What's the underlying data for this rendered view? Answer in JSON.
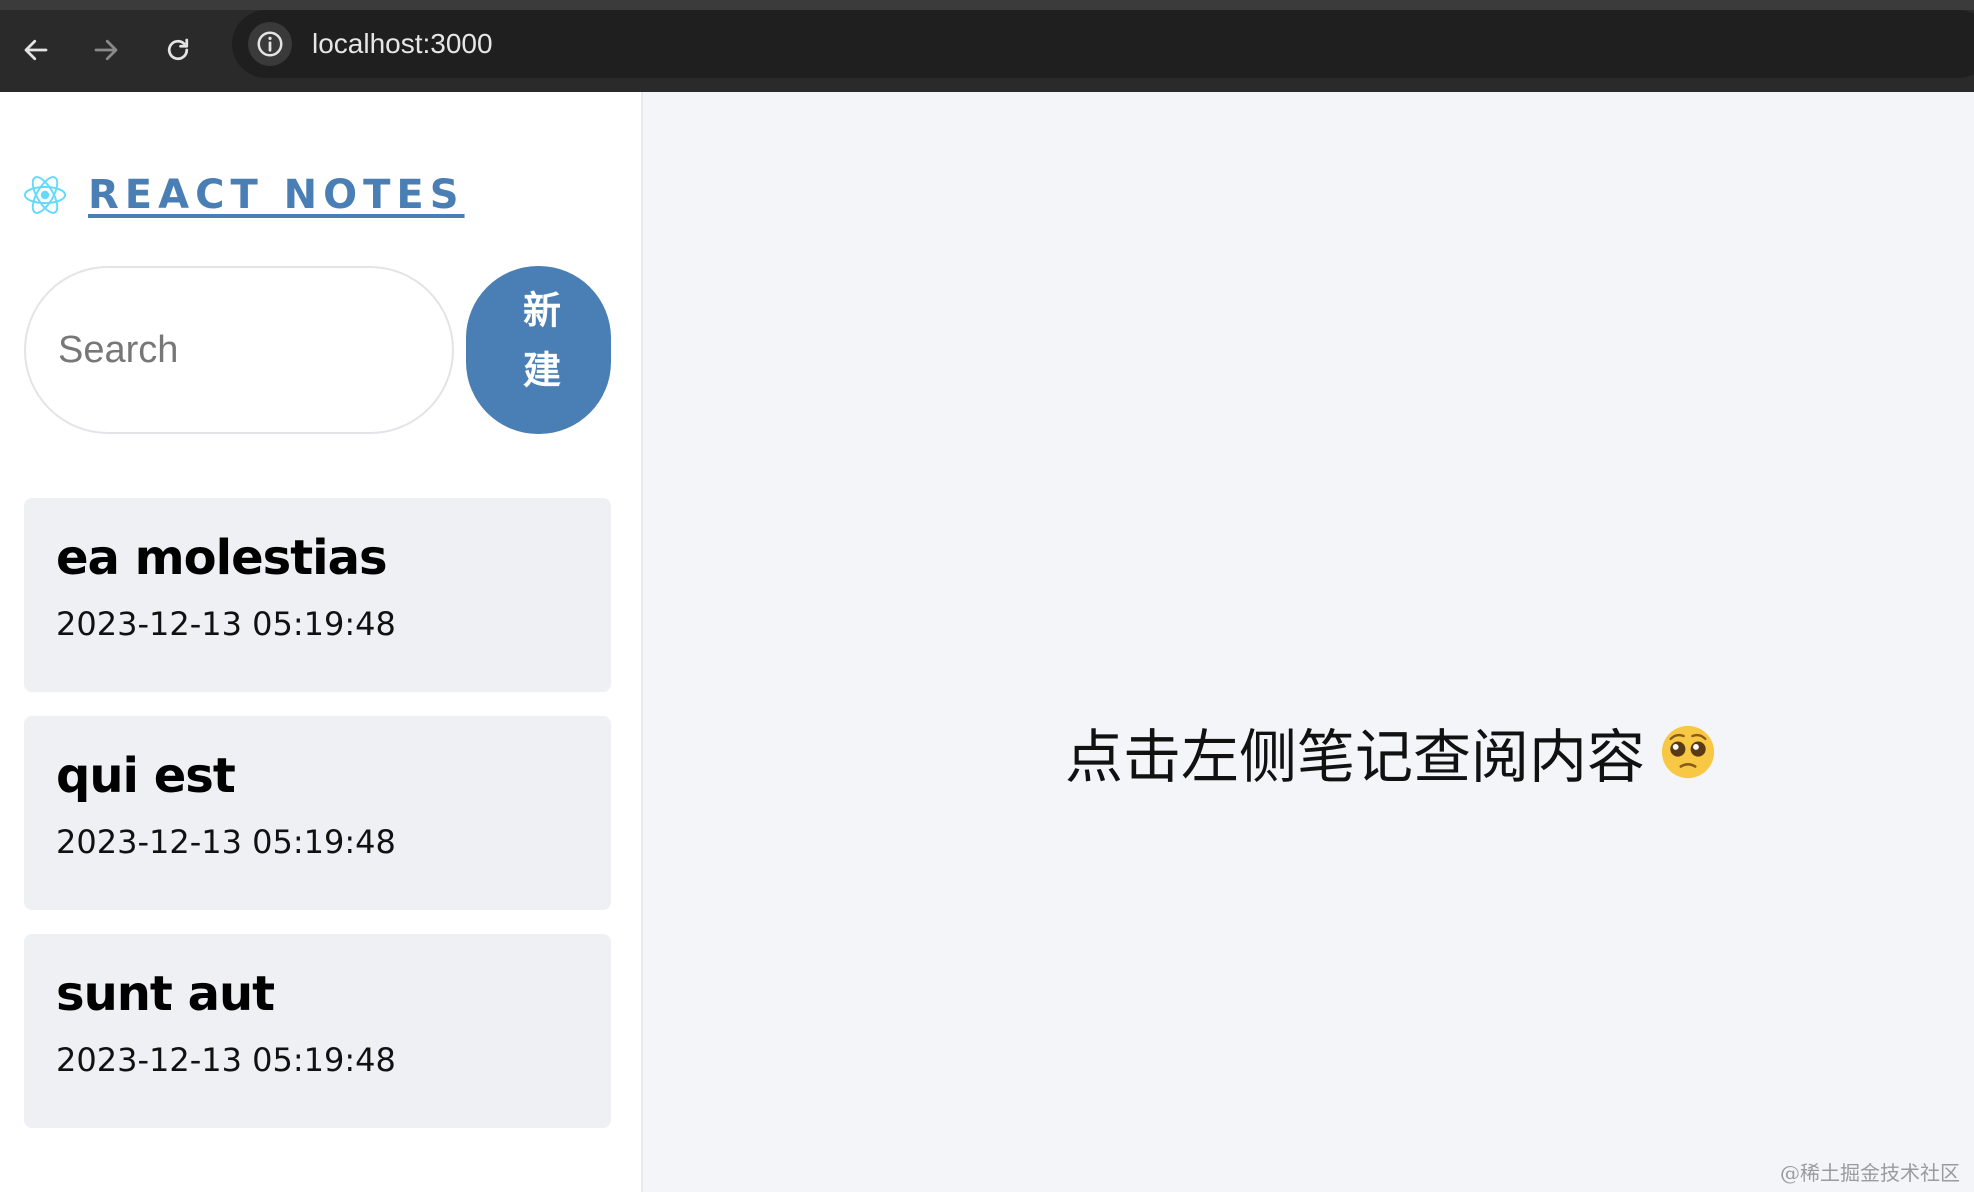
{
  "browser": {
    "url": "localhost:3000",
    "back_icon": "arrow-left-icon",
    "forward_icon": "arrow-right-icon",
    "reload_icon": "reload-icon",
    "info_icon": "info-icon"
  },
  "sidebar": {
    "brand": "REACT NOTES",
    "brand_icon": "react-logo-icon",
    "search_placeholder": "Search",
    "search_value": "",
    "new_button_label": "新建",
    "notes": [
      {
        "title": "ea molestias",
        "date": "2023-12-13 05:19:48"
      },
      {
        "title": "qui est",
        "date": "2023-12-13 05:19:48"
      },
      {
        "title": "sunt aut",
        "date": "2023-12-13 05:19:48"
      }
    ]
  },
  "main": {
    "empty_message": "点击左侧笔记查阅内容",
    "emoji_icon": "pleading-face-icon"
  },
  "watermark": "@稀土掘金技术社区",
  "colors": {
    "accent": "#4a7fb5",
    "card_bg": "#eff0f4",
    "main_bg": "#f4f5f9",
    "chrome_bg": "#2a2a2b"
  }
}
